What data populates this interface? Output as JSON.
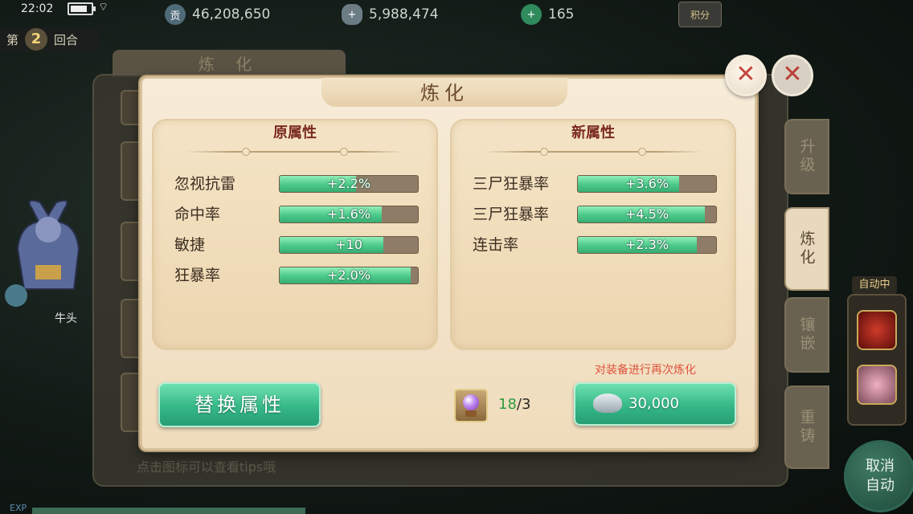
{
  "status_bar": {
    "time": "22:02",
    "battery_level": 0.85,
    "currency_1": "46,208,650",
    "currency_2": "5,988,474",
    "currency_3": "165",
    "score_button": "积分"
  },
  "round": {
    "prefix": "第",
    "number": "2",
    "suffix": "回合"
  },
  "background_window": {
    "title": "炼 化",
    "hint": "点击图标可以查看tips哦",
    "close_glyph": "✕"
  },
  "side_tabs": [
    {
      "label": "升级",
      "active": false
    },
    {
      "label": "炼化",
      "active": true
    },
    {
      "label": "镶嵌",
      "active": false
    },
    {
      "label": "重铸",
      "active": false
    }
  ],
  "auto_battle": {
    "label": "自动中",
    "cancel_label_1": "取消",
    "cancel_label_2": "自动"
  },
  "character": {
    "name": "牛头",
    "exp_label": "EXP"
  },
  "dialog": {
    "title": "炼化",
    "close_glyph": "✕",
    "original": {
      "header": "原属性",
      "attributes": [
        {
          "name": "忽视抗雷",
          "value": "+2.2%",
          "fill": 0.55
        },
        {
          "name": "命中率",
          "value": "+1.6%",
          "fill": 0.74
        },
        {
          "name": "敏捷",
          "value": "+10",
          "fill": 0.75
        },
        {
          "name": "狂暴率",
          "value": "+2.0%",
          "fill": 0.95
        }
      ]
    },
    "new": {
      "header": "新属性",
      "attributes": [
        {
          "name": "三尸狂暴率",
          "value": "+3.6%",
          "fill": 0.73
        },
        {
          "name": "三尸狂暴率",
          "value": "+4.5%",
          "fill": 0.92
        },
        {
          "name": "连击率",
          "value": "+2.3%",
          "fill": 0.86
        }
      ]
    },
    "refine_hint": "对装备进行再次炼化",
    "replace_button": "替换属性",
    "item_count_have": "18",
    "item_count_sep": "/",
    "item_count_need": "3",
    "refine_cost": "30,000"
  }
}
